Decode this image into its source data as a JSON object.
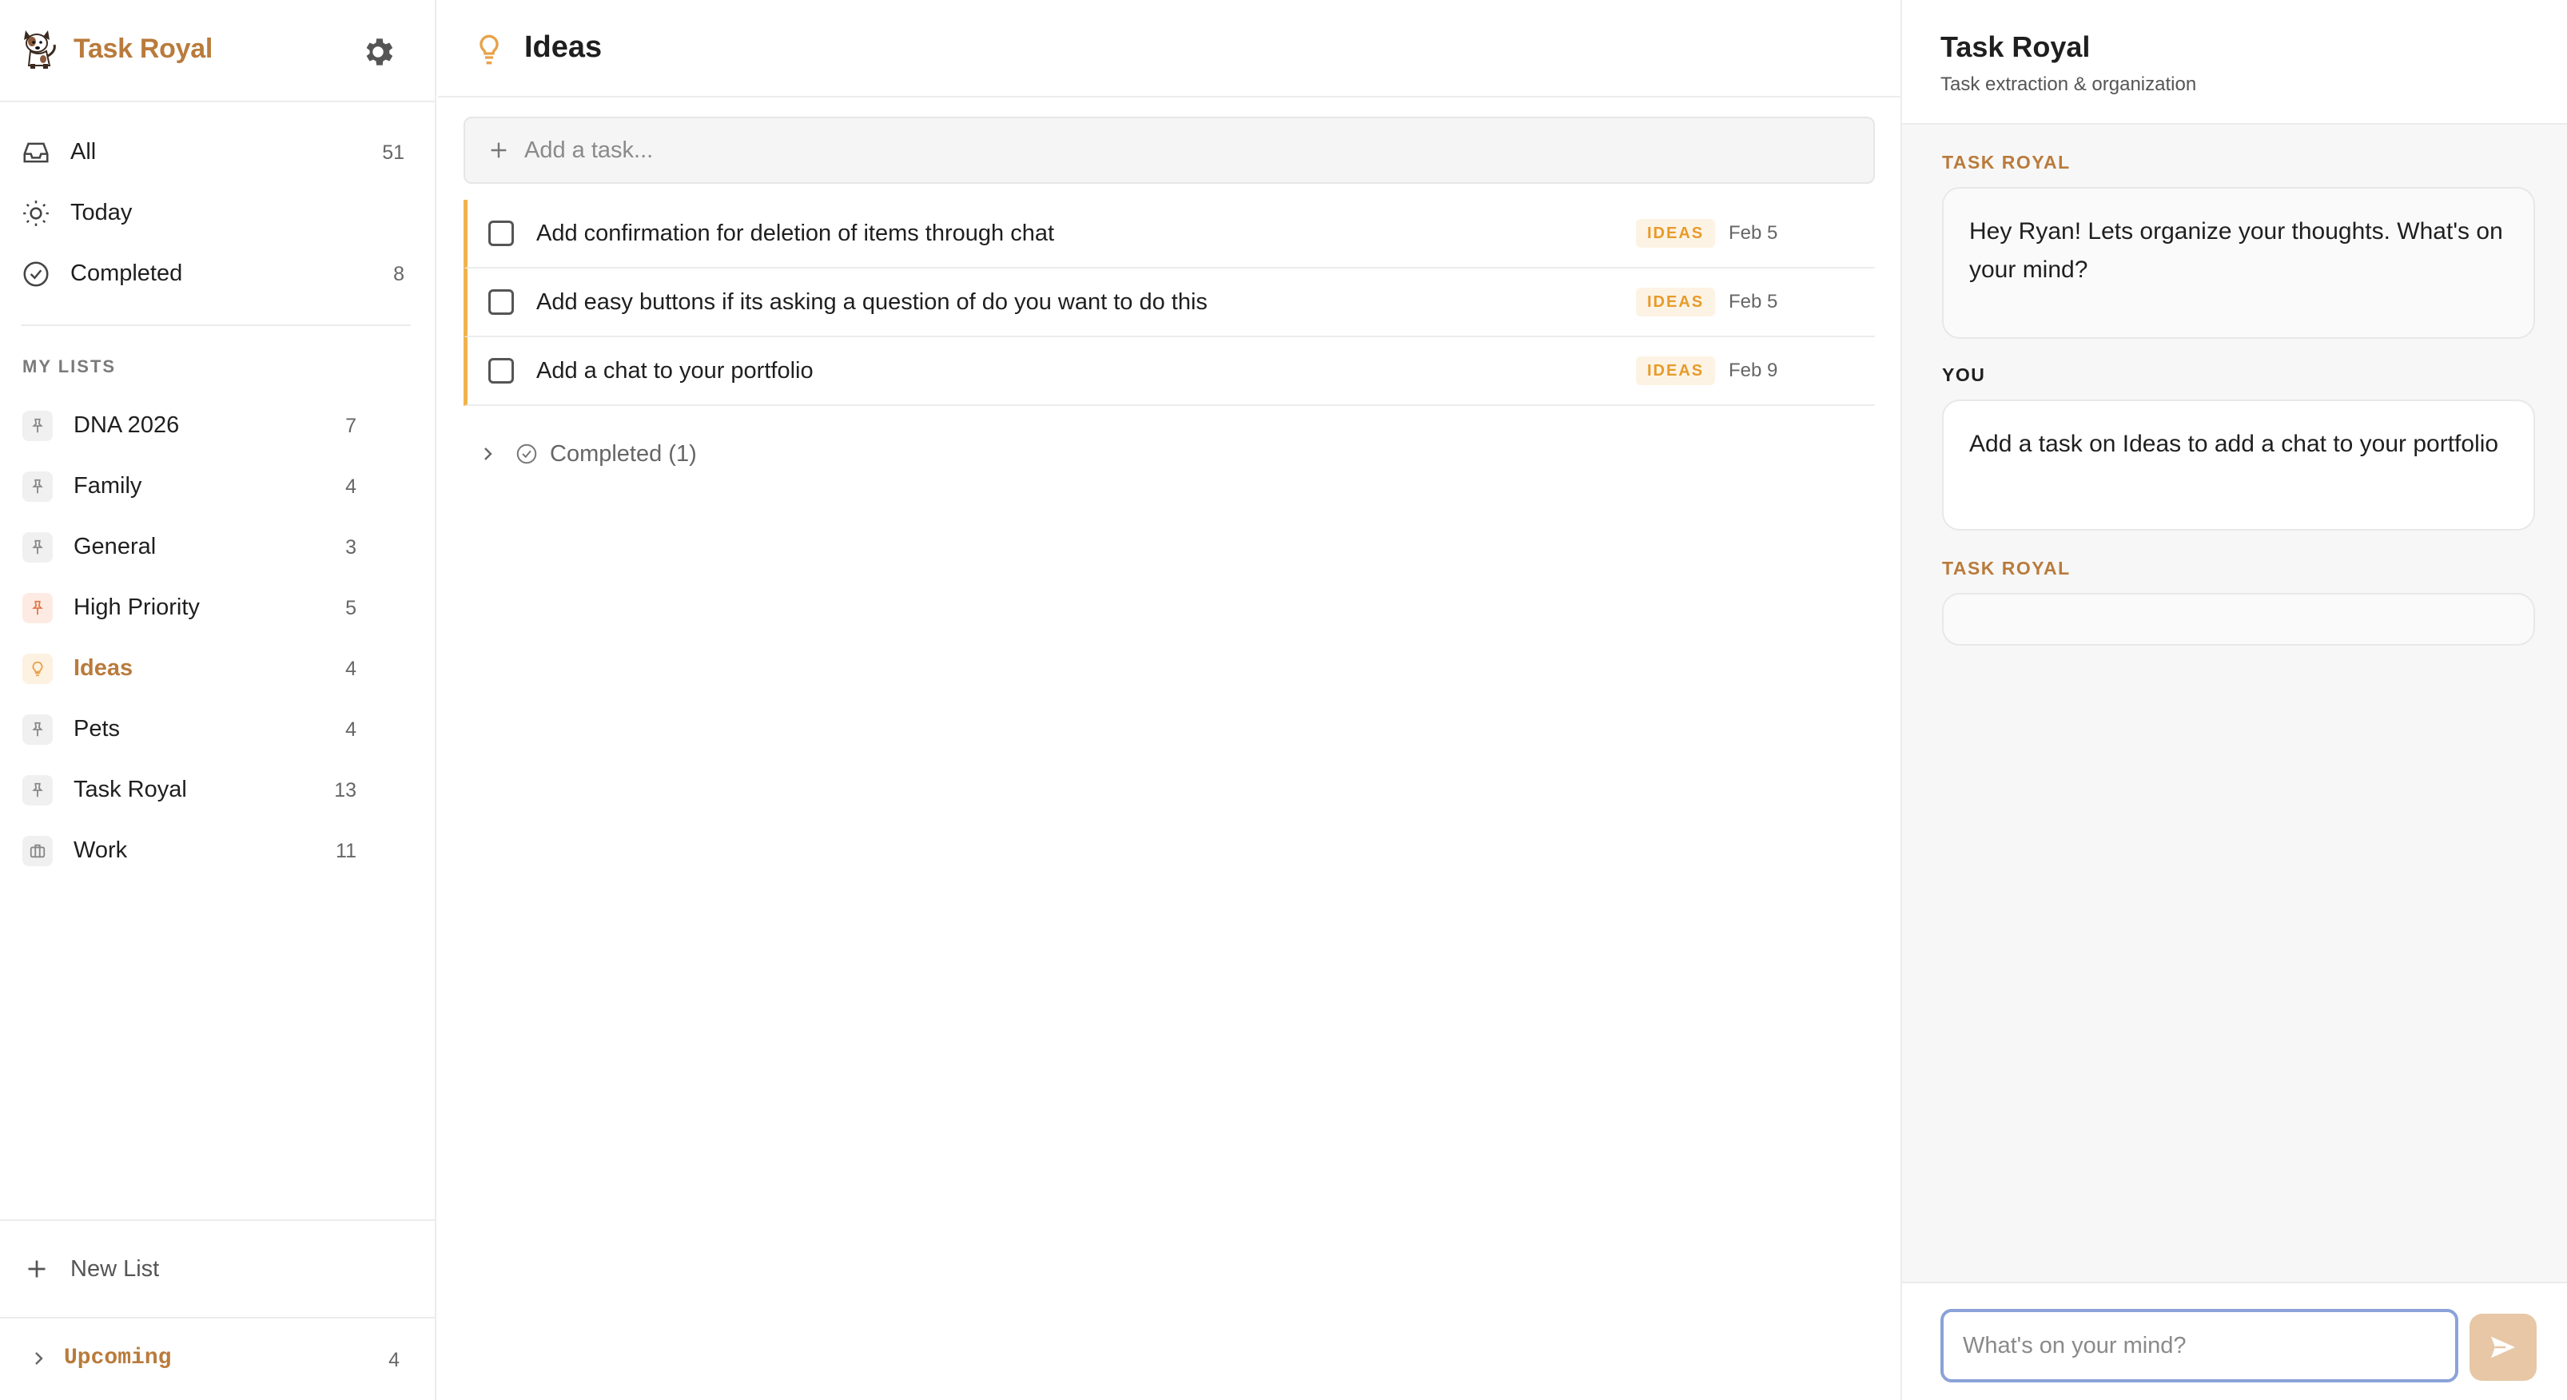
{
  "app": {
    "name": "Task Royal"
  },
  "sidebar": {
    "smart_lists": [
      {
        "label": "All",
        "count": "51",
        "icon": "inbox-icon"
      },
      {
        "label": "Today",
        "count": "",
        "icon": "sun-icon"
      },
      {
        "label": "Completed",
        "count": "8",
        "icon": "check-circle-icon"
      }
    ],
    "my_lists_header": "MY LISTS",
    "lists": [
      {
        "label": "DNA 2026",
        "count": "7",
        "icon": "pin-icon"
      },
      {
        "label": "Family",
        "count": "4",
        "icon": "pin-icon"
      },
      {
        "label": "General",
        "count": "3",
        "icon": "pin-icon"
      },
      {
        "label": "High Priority",
        "count": "5",
        "icon": "pin-icon"
      },
      {
        "label": "Ideas",
        "count": "4",
        "icon": "lightbulb-icon"
      },
      {
        "label": "Pets",
        "count": "4",
        "icon": "pin-icon"
      },
      {
        "label": "Task Royal",
        "count": "13",
        "icon": "pin-icon"
      },
      {
        "label": "Work",
        "count": "11",
        "icon": "briefcase-icon"
      }
    ],
    "new_list_label": "New List",
    "upcoming": {
      "label": "Upcoming",
      "count": "4"
    }
  },
  "main": {
    "title": "Ideas",
    "add_task_placeholder": "Add a task...",
    "tasks": [
      {
        "text": "Add confirmation for deletion of items through chat",
        "tag": "IDEAS",
        "date": "Feb 5"
      },
      {
        "text": "Add easy buttons if its asking a question of do you want to do this",
        "tag": "IDEAS",
        "date": "Feb 5"
      },
      {
        "text": "Add a chat to your portfolio",
        "tag": "IDEAS",
        "date": "Feb 9"
      }
    ],
    "completed_toggle": "Completed (1)"
  },
  "chat": {
    "title": "Task Royal",
    "subtitle": "Task extraction & organization",
    "messages": [
      {
        "speaker": "TASK ROYAL",
        "text": "Hey Ryan! Lets organize your thoughts. What's on your mind?"
      },
      {
        "speaker": "YOU",
        "text": "Add a task on Ideas to add a chat to your portfolio"
      },
      {
        "speaker": "TASK ROYAL",
        "text": ""
      }
    ],
    "input_placeholder": "What's on your mind?"
  },
  "colors": {
    "accent": "#b97b3c",
    "tag": "#e79b2a",
    "task_border": "#f0b34c",
    "send": "#e7c7a6"
  }
}
